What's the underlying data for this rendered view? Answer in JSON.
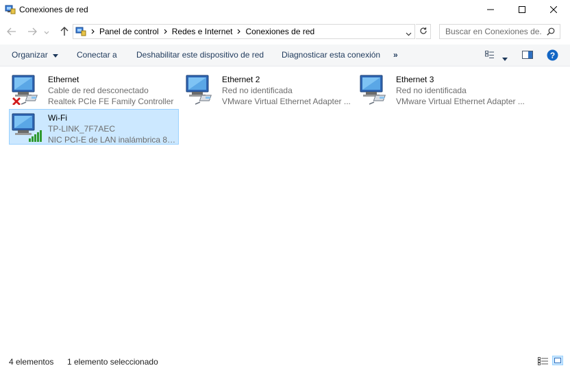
{
  "window": {
    "title": "Conexiones de red",
    "icons": {
      "app": "network-connections-icon",
      "minimize": "minimize-icon",
      "maximize": "maximize-icon",
      "close": "close-icon"
    }
  },
  "navigation": {
    "breadcrumb": [
      {
        "label": "Panel de control"
      },
      {
        "label": "Redes e Internet"
      },
      {
        "label": "Conexiones de red"
      }
    ],
    "search_placeholder": "Buscar en Conexiones de..."
  },
  "toolbar": {
    "organize": "Organizar",
    "connect": "Conectar a",
    "disable": "Deshabilitar este dispositivo de red",
    "diagnose": "Diagnosticar esta conexión",
    "more": "»"
  },
  "connections": [
    {
      "name": "Ethernet",
      "status": "Cable de red desconectado",
      "adapter": "Realtek PCIe FE Family Controller",
      "type": "ethernet-disconnected",
      "selected": false
    },
    {
      "name": "Ethernet 2",
      "status": "Red no identificada",
      "adapter": "VMware Virtual Ethernet Adapter ...",
      "type": "ethernet",
      "selected": false
    },
    {
      "name": "Ethernet 3",
      "status": "Red no identificada",
      "adapter": "VMware Virtual Ethernet Adapter ...",
      "type": "ethernet",
      "selected": false
    },
    {
      "name": "Wi-Fi",
      "status": "TP-LINK_7F7AEC",
      "adapter": "NIC PCI-E de LAN inalámbrica 80...",
      "type": "wifi",
      "selected": true
    }
  ],
  "status_bar": {
    "count": "4 elementos",
    "selection": "1 elemento seleccionado"
  },
  "colors": {
    "selection_bg": "#cce8ff",
    "selection_border": "#99d1ff",
    "toolbar_bg": "#f5f6f7",
    "link_text": "#1e395b",
    "help_blue": "#1366c4"
  }
}
